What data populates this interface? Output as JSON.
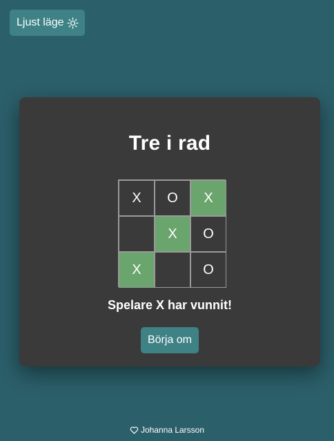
{
  "theme_toggle": {
    "label": "Ljust läge",
    "icon": "sun-icon"
  },
  "game": {
    "title": "Tre i rad",
    "board": [
      {
        "value": "X",
        "winning": false
      },
      {
        "value": "O",
        "winning": false
      },
      {
        "value": "X",
        "winning": true
      },
      {
        "value": "",
        "winning": false
      },
      {
        "value": "X",
        "winning": true
      },
      {
        "value": "O",
        "winning": false
      },
      {
        "value": "X",
        "winning": true
      },
      {
        "value": "",
        "winning": false
      },
      {
        "value": "O",
        "winning": false
      }
    ],
    "status": "Spelare X har vunnit!",
    "restart_label": "Börja om"
  },
  "footer": {
    "icon": "heart-icon",
    "author": "Johanna Larsson"
  },
  "colors": {
    "background": "#2b5f6a",
    "card": "#3a3a3a",
    "button": "#3f8286",
    "winning_cell": "#6aa56d"
  }
}
